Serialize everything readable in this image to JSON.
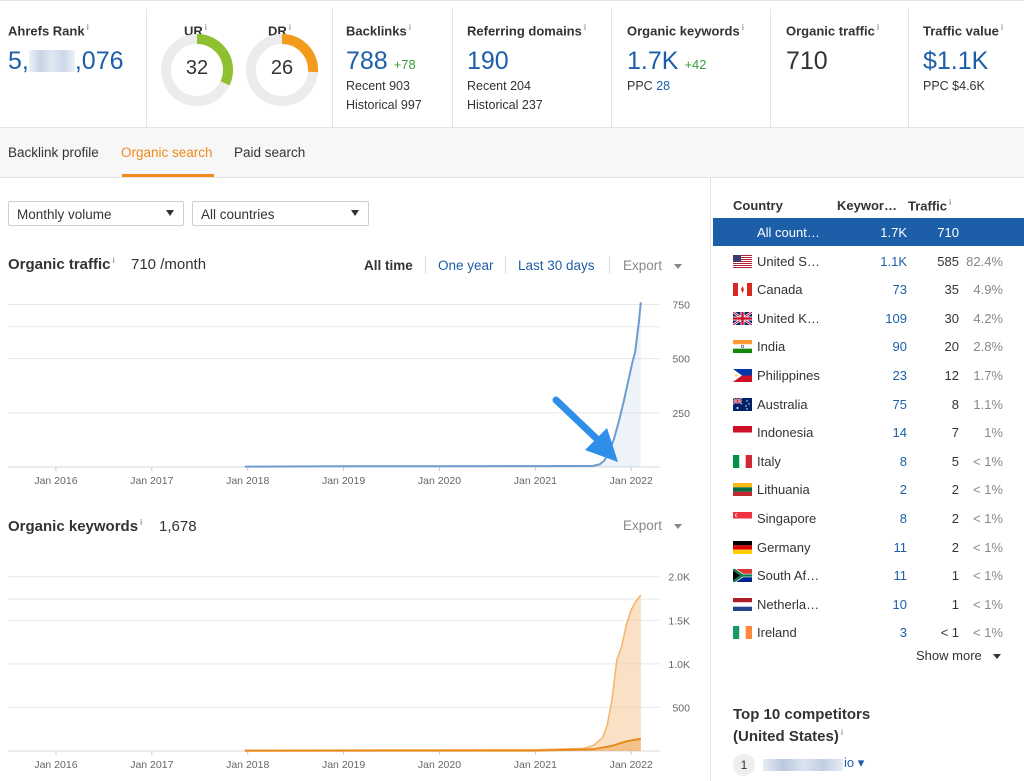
{
  "metrics": {
    "ahrefs_rank": {
      "title": "Ahrefs Rank",
      "prefix": "5,",
      "suffix": ",076"
    },
    "ur": {
      "title": "UR",
      "value": "32",
      "fraction": 0.32,
      "color": "#8fc02f"
    },
    "dr": {
      "title": "DR",
      "value": "26",
      "fraction": 0.26,
      "color": "#f29b1c"
    },
    "backlinks": {
      "title": "Backlinks",
      "value": "788",
      "delta": "+78",
      "recent": "Recent 903",
      "historical": "Historical 997"
    },
    "referring_domains": {
      "title": "Referring domains",
      "value": "190",
      "recent": "Recent 204",
      "historical": "Historical 237"
    },
    "organic_keywords": {
      "title": "Organic keywords",
      "value": "1.7K",
      "delta": "+42",
      "ppc_label": "PPC",
      "ppc_value": "28"
    },
    "organic_traffic": {
      "title": "Organic traffic",
      "value": "710"
    },
    "traffic_value": {
      "title": "Traffic value",
      "value": "$1.1K",
      "ppc": "PPC $4.6K"
    }
  },
  "tabs": [
    "Backlink profile",
    "Organic search",
    "Paid search"
  ],
  "filters": {
    "volume": "Monthly volume",
    "countries": "All countries"
  },
  "traffic_section": {
    "title": "Organic traffic",
    "value": "710 /month",
    "ranges": [
      "All time",
      "One year",
      "Last 30 days"
    ],
    "export": "Export"
  },
  "keywords_section": {
    "title": "Organic keywords",
    "value": "1,678",
    "export": "Export"
  },
  "colors": {
    "accent": "#f08a1c",
    "link": "#1c5fa8",
    "traffic_line": "#6d9ccf",
    "keywords_area": "#f6c796",
    "arrow": "#2f8fe8"
  },
  "chart_data": [
    {
      "type": "line",
      "title": "Organic traffic",
      "x_ticks": [
        "Jan 2016",
        "Jan 2017",
        "Jan 2018",
        "Jan 2019",
        "Jan 2020",
        "Jan 2021",
        "Jan 2022"
      ],
      "y_ticks": [
        "250",
        "500",
        "750"
      ],
      "ylim": [
        0,
        780
      ],
      "xlim": [
        2015.5,
        2022.3
      ],
      "series": [
        {
          "x": [
            2017.97,
            2019.0,
            2020.0,
            2021.0,
            2021.6,
            2021.67,
            2021.72,
            2021.77,
            2021.82,
            2021.87,
            2021.92,
            2021.97,
            2022.01,
            2022.04,
            2022.06,
            2022.08,
            2022.1
          ],
          "y": [
            2,
            3,
            3,
            4,
            5,
            12,
            30,
            70,
            130,
            210,
            300,
            400,
            480,
            530,
            600,
            670,
            760
          ]
        }
      ],
      "grid": true
    },
    {
      "type": "area",
      "title": "Organic keywords",
      "x_ticks": [
        "Jan 2016",
        "Jan 2017",
        "Jan 2018",
        "Jan 2019",
        "Jan 2020",
        "Jan 2021",
        "Jan 2022"
      ],
      "y_ticks": [
        "500",
        "1.0K",
        "1.5K",
        "2.0K"
      ],
      "ylim": [
        0,
        2100
      ],
      "xlim": [
        2015.5,
        2022.3
      ],
      "series": [
        {
          "x": [
            2017.97,
            2019.0,
            2020.0,
            2021.0,
            2021.5,
            2021.6,
            2021.7,
            2021.75,
            2021.8,
            2021.85,
            2021.9,
            2021.95,
            2022.0,
            2022.05,
            2022.1
          ],
          "y": [
            8,
            10,
            12,
            15,
            30,
            60,
            150,
            300,
            600,
            1050,
            1200,
            1450,
            1620,
            1720,
            1790
          ]
        },
        {
          "x": [
            2017.97,
            2021.0,
            2021.6,
            2021.8,
            2021.95,
            2022.1
          ],
          "y": [
            3,
            5,
            20,
            60,
            110,
            140
          ]
        }
      ],
      "grid": true
    }
  ],
  "countries": {
    "headers": {
      "country": "Country",
      "keywords": "Keywor…",
      "traffic": "Traffic"
    },
    "rows": [
      {
        "name": "All count…",
        "keywords": "1.7K",
        "traffic": "710",
        "pct": "",
        "flag": "none",
        "selected": true
      },
      {
        "name": "United S…",
        "keywords": "1.1K",
        "traffic": "585",
        "pct": "82.4%",
        "flag": "us"
      },
      {
        "name": "Canada",
        "keywords": "73",
        "traffic": "35",
        "pct": "4.9%",
        "flag": "ca"
      },
      {
        "name": "United K…",
        "keywords": "109",
        "traffic": "30",
        "pct": "4.2%",
        "flag": "gb"
      },
      {
        "name": "India",
        "keywords": "90",
        "traffic": "20",
        "pct": "2.8%",
        "flag": "in"
      },
      {
        "name": "Philippines",
        "keywords": "23",
        "traffic": "12",
        "pct": "1.7%",
        "flag": "ph"
      },
      {
        "name": "Australia",
        "keywords": "75",
        "traffic": "8",
        "pct": "1.1%",
        "flag": "au"
      },
      {
        "name": "Indonesia",
        "keywords": "14",
        "traffic": "7",
        "pct": "1%",
        "flag": "id"
      },
      {
        "name": "Italy",
        "keywords": "8",
        "traffic": "5",
        "pct": "< 1%",
        "flag": "it"
      },
      {
        "name": "Lithuania",
        "keywords": "2",
        "traffic": "2",
        "pct": "< 1%",
        "flag": "lt"
      },
      {
        "name": "Singapore",
        "keywords": "8",
        "traffic": "2",
        "pct": "< 1%",
        "flag": "sg"
      },
      {
        "name": "Germany",
        "keywords": "11",
        "traffic": "2",
        "pct": "< 1%",
        "flag": "de"
      },
      {
        "name": "South Af…",
        "keywords": "11",
        "traffic": "1",
        "pct": "< 1%",
        "flag": "za"
      },
      {
        "name": "Netherla…",
        "keywords": "10",
        "traffic": "1",
        "pct": "< 1%",
        "flag": "nl"
      },
      {
        "name": "Ireland",
        "keywords": "3",
        "traffic": "< 1",
        "pct": "< 1%",
        "flag": "ie"
      }
    ],
    "show_more": "Show more"
  },
  "competitors": {
    "title_line1": "Top 10 competitors",
    "title_line2": "(United States)",
    "first_rank": "1",
    "first_tld": "io"
  }
}
